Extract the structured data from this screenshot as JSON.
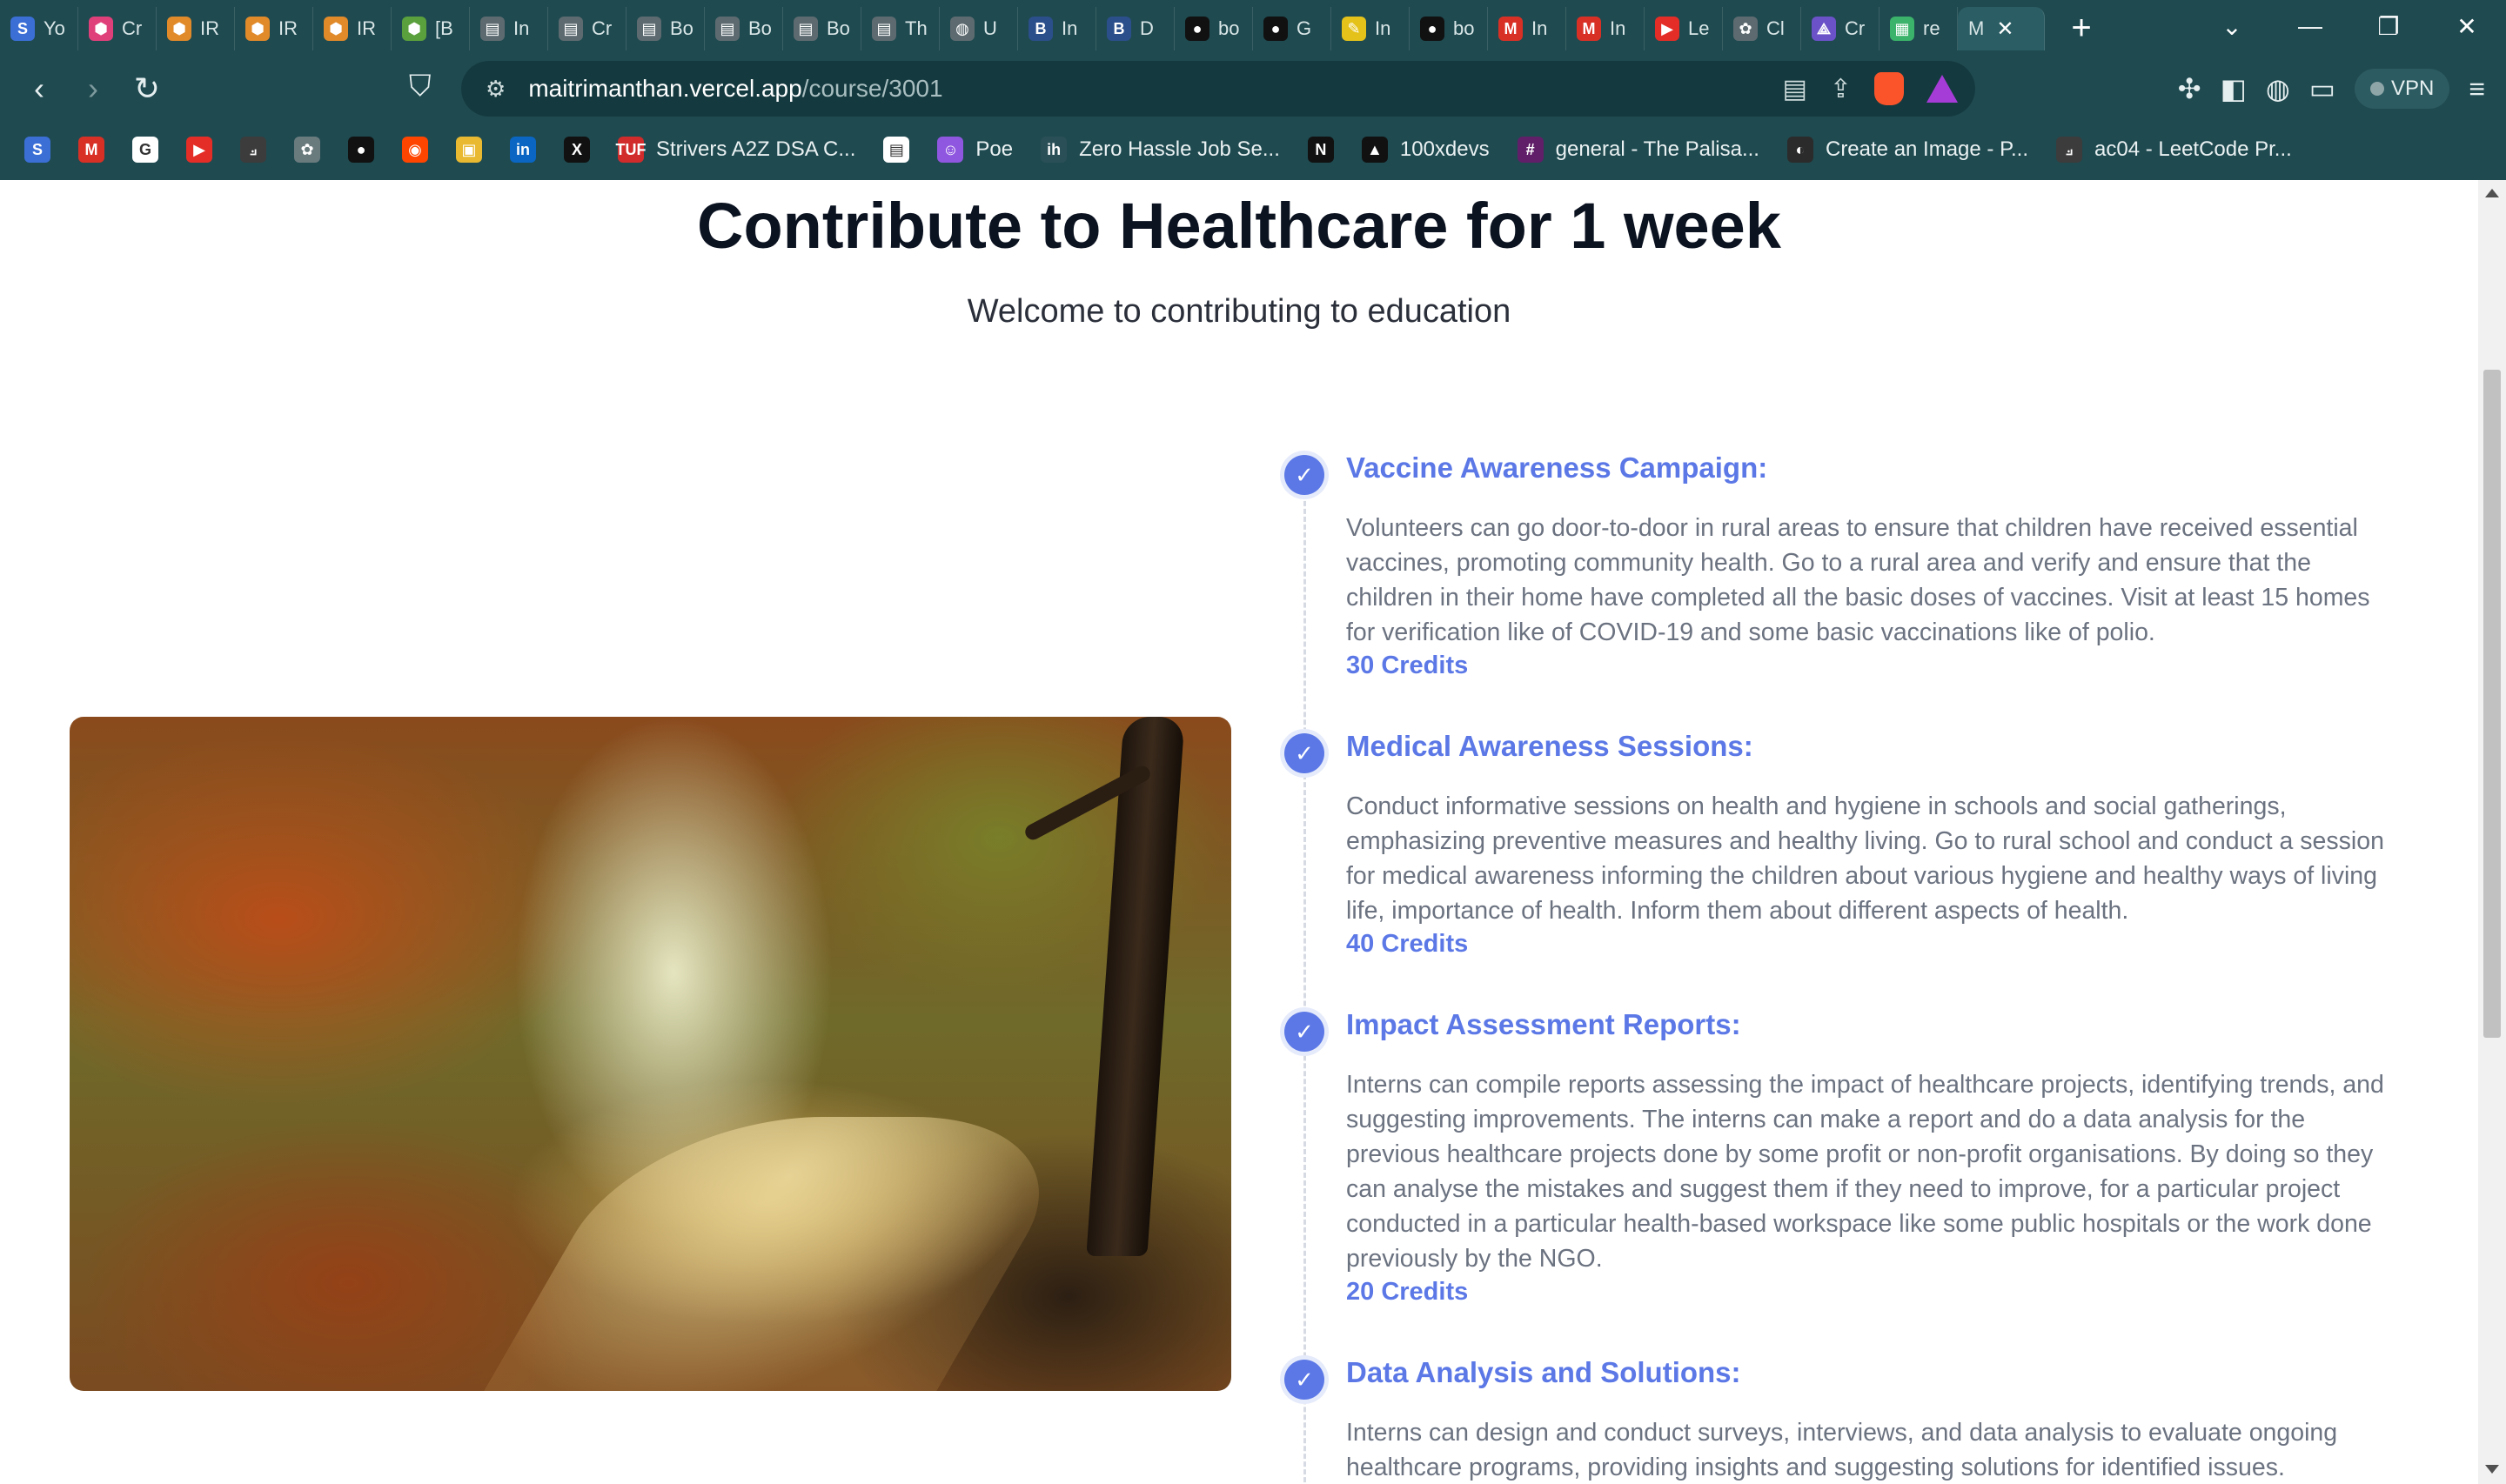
{
  "browser": {
    "tabs": [
      {
        "label": "Yo",
        "color": "#3b6fd6",
        "glyph": "S"
      },
      {
        "label": "Cr",
        "color": "#e0407a",
        "glyph": "⬢"
      },
      {
        "label": "IR",
        "color": "#e08a2a",
        "glyph": "⬢"
      },
      {
        "label": "IR",
        "color": "#e08a2a",
        "glyph": "⬢"
      },
      {
        "label": "IR",
        "color": "#e08a2a",
        "glyph": "⬢"
      },
      {
        "label": "[B",
        "color": "#5aa03c",
        "glyph": "⬢"
      },
      {
        "label": "In",
        "color": "#5d6b70",
        "glyph": "▤"
      },
      {
        "label": "Cr",
        "color": "#5d6b70",
        "glyph": "▤"
      },
      {
        "label": "Bo",
        "color": "#5d6b70",
        "glyph": "▤"
      },
      {
        "label": "Bo",
        "color": "#5d6b70",
        "glyph": "▤"
      },
      {
        "label": "Bo",
        "color": "#5d6b70",
        "glyph": "▤"
      },
      {
        "label": "Th",
        "color": "#5d6b70",
        "glyph": "▤"
      },
      {
        "label": "U",
        "color": "#5d6b70",
        "glyph": "◍"
      },
      {
        "label": "In",
        "color": "#2b4f8a",
        "glyph": "B"
      },
      {
        "label": "D",
        "color": "#2b4f8a",
        "glyph": "B"
      },
      {
        "label": "bo",
        "color": "#111111",
        "glyph": "●"
      },
      {
        "label": "G",
        "color": "#111111",
        "glyph": "●"
      },
      {
        "label": "In",
        "color": "#e4c21a",
        "glyph": "✎"
      },
      {
        "label": "bo",
        "color": "#111111",
        "glyph": "●"
      },
      {
        "label": "In",
        "color": "#d93025",
        "glyph": "M"
      },
      {
        "label": "In",
        "color": "#d93025",
        "glyph": "M"
      },
      {
        "label": "Le",
        "color": "#e52d27",
        "glyph": "▶"
      },
      {
        "label": "Cl",
        "color": "#5d6b70",
        "glyph": "✿"
      },
      {
        "label": "Cr",
        "color": "#6b52c8",
        "glyph": "⟁"
      },
      {
        "label": "re",
        "color": "#3bb36a",
        "glyph": "▦"
      }
    ],
    "active_tab": {
      "label": "M",
      "close": "✕"
    },
    "new_tab": "+",
    "window_controls": {
      "dropdown": "⌄",
      "minimize": "—",
      "restore": "❐",
      "close": "✕"
    },
    "url_host": "maitrimanthan.vercel.app",
    "url_path": "/course/3001",
    "vpn_label": "VPN",
    "bookmarks": [
      {
        "label": "",
        "color": "#3b6fd6",
        "glyph": "S"
      },
      {
        "label": "",
        "color": "#d93025",
        "glyph": "M"
      },
      {
        "label": "",
        "color": "#ffffff",
        "glyph": "G"
      },
      {
        "label": "",
        "color": "#e52d27",
        "glyph": "▶"
      },
      {
        "label": "",
        "color": "#3c3c3c",
        "glyph": "⟓"
      },
      {
        "label": "",
        "color": "#6a7b7e",
        "glyph": "✿"
      },
      {
        "label": "",
        "color": "#111111",
        "glyph": "●"
      },
      {
        "label": "",
        "color": "#ff4500",
        "glyph": "◉"
      },
      {
        "label": "",
        "color": "#e8b931",
        "glyph": "▣"
      },
      {
        "label": "",
        "color": "#0a66c2",
        "glyph": "in"
      },
      {
        "label": "",
        "color": "#111111",
        "glyph": "X"
      },
      {
        "label": "Strivers A2Z DSA C...",
        "color": "#d12b2b",
        "glyph": "TUF"
      },
      {
        "label": "",
        "color": "#ffffff",
        "glyph": "▤"
      },
      {
        "label": "Poe",
        "color": "#8f57e0",
        "glyph": "☺"
      },
      {
        "label": "Zero Hassle Job Se...",
        "color": "#2b4f57",
        "glyph": "ih"
      },
      {
        "label": "",
        "color": "#111111",
        "glyph": "N"
      },
      {
        "label": "100xdevs",
        "color": "#111111",
        "glyph": "▲"
      },
      {
        "label": "general - The Palisa...",
        "color": "#611f69",
        "glyph": "#"
      },
      {
        "label": "Create an Image - P...",
        "color": "#2b2b2b",
        "glyph": "◐"
      },
      {
        "label": "ac04 - LeetCode Pr...",
        "color": "#3c3c3c",
        "glyph": "⟓"
      }
    ]
  },
  "page": {
    "title": "Contribute to Healthcare for 1 week",
    "subtitle": "Welcome to contributing to education",
    "steps": [
      {
        "title": "Vaccine Awareness Campaign:",
        "description": "Volunteers can go door-to-door in rural areas to ensure that children have received essential vaccines, promoting community health. Go to a rural area and verify and ensure that the children in their home have completed all the basic doses of vaccines. Visit at least 15 homes for verification like of COVID-19 and some basic vaccinations like of polio.",
        "credits": "30 Credits"
      },
      {
        "title": "Medical Awareness Sessions:",
        "description": "Conduct informative sessions on health and hygiene in schools and social gatherings, emphasizing preventive measures and healthy living. Go to rural school and conduct a session for medical awareness informing the children about various hygiene and healthy ways of living life, importance of health. Inform them about different aspects of health.",
        "credits": "40 Credits"
      },
      {
        "title": "Impact Assessment Reports:",
        "description": "Interns can compile reports assessing the impact of healthcare projects, identifying trends, and suggesting improvements. The interns can make a report and do a data analysis for the previous healthcare projects done by some profit or non-profit organisations. By doing so they can analyse the mistakes and suggest them if they need to improve, for a particular project conducted in a particular health-based workspace like some public hospitals or the work done previously by the NGO.",
        "credits": "20 Credits"
      },
      {
        "title": "Data Analysis and Solutions:",
        "description": "Interns can design and conduct surveys, interviews, and data analysis to evaluate ongoing healthcare programs, providing insights and suggesting solutions for identified issues.",
        "credits": ""
      }
    ]
  },
  "colors": {
    "accent": "#5b78e6",
    "heading": "#0b1220",
    "body_text": "#6b7280",
    "chrome": "#1f4a50"
  }
}
